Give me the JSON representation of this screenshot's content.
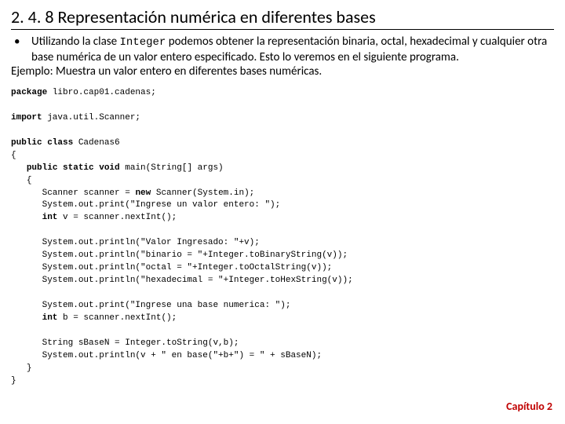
{
  "heading": "2. 4. 8 Representación numérica en diferentes bases",
  "bullet": {
    "marker": "•",
    "pre": "Utilizando la clase ",
    "code": "Integer",
    "post": " podemos obtener la representación binaria, octal, hexadecimal y cualquier otra base numérica de un valor entero especificado. Esto lo veremos en el siguiente programa."
  },
  "example": "Ejemplo: Muestra un valor entero en diferentes bases numéricas.",
  "code": {
    "pkg_kw": "package",
    "pkg_rest": " libro.cap01.cadenas;",
    "imp_kw": "import",
    "imp_rest": " java.util.Scanner;",
    "cls_kw": "public class",
    "cls_rest": " Cadenas6",
    "ob": "{",
    "cb": "}",
    "main_kw": "public static void",
    "main_rest": " main(String[] args)",
    "l_scanner_pre": "      Scanner scanner = ",
    "new_kw": "new",
    "l_scanner_post": " Scanner(System.in);",
    "l_prompt1": "      System.out.print(\"Ingrese un valor entero: \");",
    "int_kw": "int",
    "l_v_pre": "      ",
    "l_v_post": " v = scanner.nextInt();",
    "l_out1": "      System.out.println(\"Valor Ingresado: \"+v);",
    "l_out2": "      System.out.println(\"binario = \"+Integer.toBinaryString(v));",
    "l_out3": "      System.out.println(\"octal = \"+Integer.toOctalString(v));",
    "l_out4": "      System.out.println(\"hexadecimal = \"+Integer.toHexString(v));",
    "l_prompt2": "      System.out.print(\"Ingrese una base numerica: \");",
    "l_b_pre": "      ",
    "l_b_post": " b = scanner.nextInt();",
    "l_sbase": "      String sBaseN = Integer.toString(v,b);",
    "l_out5": "      System.out.println(v + \" en base(\"+b+\") = \" + sBaseN);"
  },
  "footer": "Capítulo 2"
}
